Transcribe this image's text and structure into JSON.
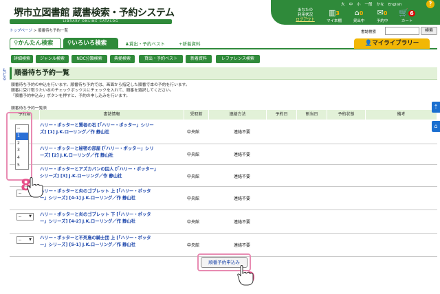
{
  "header": {
    "title": "堺市立図書館 蔵書検索・予約システム",
    "subtitle": "LIBRARY ONLINE CATALOG",
    "text_size": [
      "大",
      "中",
      "小"
    ],
    "languages": [
      "一般",
      "かな",
      "English"
    ],
    "help": "?",
    "status_line1": "あなたの",
    "status_line2": "利用状況",
    "logout": "ログアウト",
    "my_books": {
      "label": "マイ本棚",
      "count": "3"
    },
    "borrowing": {
      "label": "貸出中",
      "count": "0"
    },
    "reserved": {
      "label": "予約中",
      "count": "0"
    },
    "cart": {
      "label": "カート",
      "count": "6"
    }
  },
  "breadcrumb": {
    "home": "トップページ",
    "sep": ">",
    "current": "順番待ち予約一覧"
  },
  "search": {
    "label": "書誌検索",
    "button": "検索",
    "placeholder": ""
  },
  "tabs": {
    "simple": "かんたん検索",
    "advanced": "いろいろ検索",
    "best": "貸出・予約ベスト",
    "new": "新着資料"
  },
  "mylibrary": "マイライブラリー",
  "subnav": [
    "詳細検索",
    "ジャンル検索",
    "NDC分類検索",
    "典拠検索",
    "貸出・予約ベスト",
    "新着資料",
    "レファレンス検索"
  ],
  "side_back": "もどる",
  "page": {
    "heading": "順番待ち予約一覧",
    "desc1": "順番待ち予約の申込を行います。順番待ち予約では、画面から指定した順番で本の予約を行います。",
    "desc2": "順番に受け取りたい本のチェックボックスにチェックを入れて、順番を選択してください。",
    "desc3": "「順番予約申込み」ボタンを押すと、予約の申し込みを行います。",
    "table_caption": "順番待ち予約一覧表"
  },
  "table": {
    "headers": [
      "予約順",
      "書誌情報",
      "受取館",
      "連絡方法",
      "予約日",
      "割当日",
      "予約状態",
      "備考"
    ],
    "rows": [
      {
        "title": "ハリー・ポッターと賢者の石 [「ハリー・ポッター」シリーズ] [1] J.K.ローリング／作 静山社",
        "library": "中央館",
        "contact": "連絡不要"
      },
      {
        "title": "ハリー・ポッターと秘密の部屋 [「ハリー・ポッター」シリーズ] [2] J.K.ローリング／作 静山社",
        "library": "中央館",
        "contact": "連絡不要"
      },
      {
        "title": "ハリー・ポッターとアズカバンの囚人 [「ハリー・ポッター」シリーズ] [3] J.K.ローリング／作 静山社",
        "library": "中央館",
        "contact": "連絡不要"
      },
      {
        "title": "ハリー・ポッターと炎のゴブレット 上 [「ハリー・ポッター」シリーズ] [4-1] J.K.ローリング／作 静山社",
        "library": "中央館",
        "contact": "連絡不要"
      },
      {
        "title": "ハリー・ポッターと炎のゴブレット 下 [「ハリー・ポッター」シリーズ] [4-2] J.K.ローリング／作 静山社",
        "library": "中央館",
        "contact": "連絡不要"
      },
      {
        "title": "ハリー・ポッターと不死鳥の騎士団 上 [「ハリー・ポッター」シリーズ] [5-1] J.K.ローリング／作 静山社",
        "library": "中央館",
        "contact": "連絡不要"
      }
    ],
    "select_default": "--",
    "dropdown_options": [
      "--",
      "1",
      "2",
      "3",
      "4",
      "5",
      "6"
    ],
    "dropdown_selected": "1"
  },
  "submit_button": "順番予約申込み",
  "step_badges": [
    "8",
    "9"
  ]
}
